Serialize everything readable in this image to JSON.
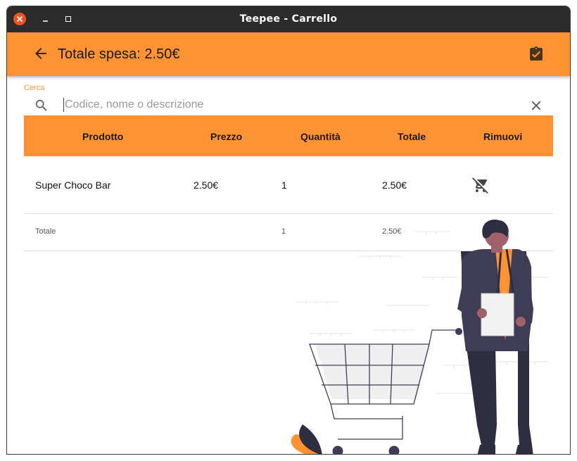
{
  "window": {
    "title": "Teepee - Carrello"
  },
  "appbar": {
    "title": "Totale spesa: 2.50€"
  },
  "search": {
    "label": "Cerca",
    "placeholder": "Codice, nome o descrizione",
    "value": ""
  },
  "table": {
    "headers": [
      "Prodotto",
      "Prezzo",
      "Quantità",
      "Totale",
      "Rimuovi"
    ],
    "rows": [
      {
        "product": "Super Choco Bar",
        "price": "2.50€",
        "quantity": "1",
        "total": "2.50€"
      }
    ],
    "footer": {
      "label": "Totale",
      "quantity": "1",
      "total": "2.50€"
    }
  },
  "colors": {
    "accent": "#ff9334",
    "titlebar": "#2c2c2c",
    "close": "#e95420"
  },
  "icons": [
    "close-icon",
    "minimize-icon",
    "maximize-icon",
    "arrow-back-icon",
    "clipboard-check-icon",
    "search-icon",
    "clear-icon",
    "remove-cart-icon"
  ]
}
